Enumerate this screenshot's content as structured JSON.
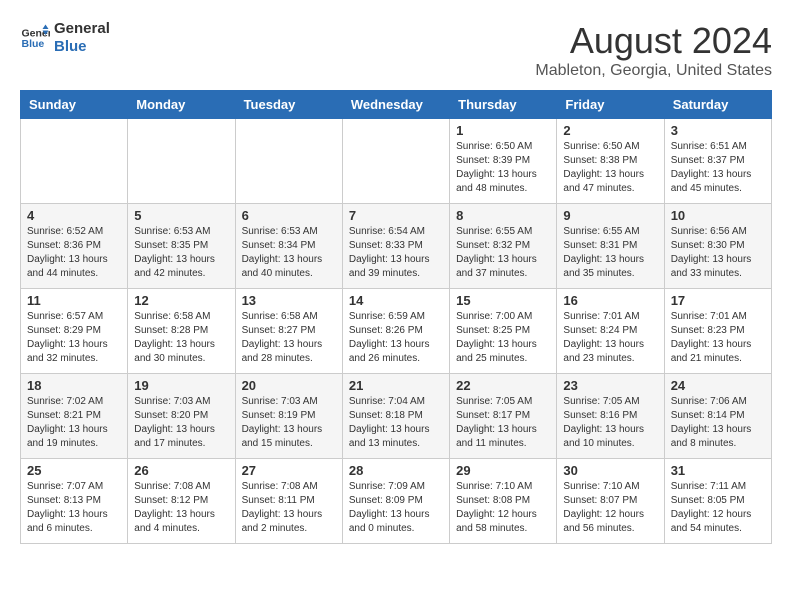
{
  "header": {
    "logo_line1": "General",
    "logo_line2": "Blue",
    "month_year": "August 2024",
    "location": "Mableton, Georgia, United States"
  },
  "days_of_week": [
    "Sunday",
    "Monday",
    "Tuesday",
    "Wednesday",
    "Thursday",
    "Friday",
    "Saturday"
  ],
  "weeks": [
    [
      {
        "day": "",
        "sunrise": "",
        "sunset": "",
        "daylight": ""
      },
      {
        "day": "",
        "sunrise": "",
        "sunset": "",
        "daylight": ""
      },
      {
        "day": "",
        "sunrise": "",
        "sunset": "",
        "daylight": ""
      },
      {
        "day": "",
        "sunrise": "",
        "sunset": "",
        "daylight": ""
      },
      {
        "day": "1",
        "sunrise": "Sunrise: 6:50 AM",
        "sunset": "Sunset: 8:39 PM",
        "daylight": "Daylight: 13 hours and 48 minutes."
      },
      {
        "day": "2",
        "sunrise": "Sunrise: 6:50 AM",
        "sunset": "Sunset: 8:38 PM",
        "daylight": "Daylight: 13 hours and 47 minutes."
      },
      {
        "day": "3",
        "sunrise": "Sunrise: 6:51 AM",
        "sunset": "Sunset: 8:37 PM",
        "daylight": "Daylight: 13 hours and 45 minutes."
      }
    ],
    [
      {
        "day": "4",
        "sunrise": "Sunrise: 6:52 AM",
        "sunset": "Sunset: 8:36 PM",
        "daylight": "Daylight: 13 hours and 44 minutes."
      },
      {
        "day": "5",
        "sunrise": "Sunrise: 6:53 AM",
        "sunset": "Sunset: 8:35 PM",
        "daylight": "Daylight: 13 hours and 42 minutes."
      },
      {
        "day": "6",
        "sunrise": "Sunrise: 6:53 AM",
        "sunset": "Sunset: 8:34 PM",
        "daylight": "Daylight: 13 hours and 40 minutes."
      },
      {
        "day": "7",
        "sunrise": "Sunrise: 6:54 AM",
        "sunset": "Sunset: 8:33 PM",
        "daylight": "Daylight: 13 hours and 39 minutes."
      },
      {
        "day": "8",
        "sunrise": "Sunrise: 6:55 AM",
        "sunset": "Sunset: 8:32 PM",
        "daylight": "Daylight: 13 hours and 37 minutes."
      },
      {
        "day": "9",
        "sunrise": "Sunrise: 6:55 AM",
        "sunset": "Sunset: 8:31 PM",
        "daylight": "Daylight: 13 hours and 35 minutes."
      },
      {
        "day": "10",
        "sunrise": "Sunrise: 6:56 AM",
        "sunset": "Sunset: 8:30 PM",
        "daylight": "Daylight: 13 hours and 33 minutes."
      }
    ],
    [
      {
        "day": "11",
        "sunrise": "Sunrise: 6:57 AM",
        "sunset": "Sunset: 8:29 PM",
        "daylight": "Daylight: 13 hours and 32 minutes."
      },
      {
        "day": "12",
        "sunrise": "Sunrise: 6:58 AM",
        "sunset": "Sunset: 8:28 PM",
        "daylight": "Daylight: 13 hours and 30 minutes."
      },
      {
        "day": "13",
        "sunrise": "Sunrise: 6:58 AM",
        "sunset": "Sunset: 8:27 PM",
        "daylight": "Daylight: 13 hours and 28 minutes."
      },
      {
        "day": "14",
        "sunrise": "Sunrise: 6:59 AM",
        "sunset": "Sunset: 8:26 PM",
        "daylight": "Daylight: 13 hours and 26 minutes."
      },
      {
        "day": "15",
        "sunrise": "Sunrise: 7:00 AM",
        "sunset": "Sunset: 8:25 PM",
        "daylight": "Daylight: 13 hours and 25 minutes."
      },
      {
        "day": "16",
        "sunrise": "Sunrise: 7:01 AM",
        "sunset": "Sunset: 8:24 PM",
        "daylight": "Daylight: 13 hours and 23 minutes."
      },
      {
        "day": "17",
        "sunrise": "Sunrise: 7:01 AM",
        "sunset": "Sunset: 8:23 PM",
        "daylight": "Daylight: 13 hours and 21 minutes."
      }
    ],
    [
      {
        "day": "18",
        "sunrise": "Sunrise: 7:02 AM",
        "sunset": "Sunset: 8:21 PM",
        "daylight": "Daylight: 13 hours and 19 minutes."
      },
      {
        "day": "19",
        "sunrise": "Sunrise: 7:03 AM",
        "sunset": "Sunset: 8:20 PM",
        "daylight": "Daylight: 13 hours and 17 minutes."
      },
      {
        "day": "20",
        "sunrise": "Sunrise: 7:03 AM",
        "sunset": "Sunset: 8:19 PM",
        "daylight": "Daylight: 13 hours and 15 minutes."
      },
      {
        "day": "21",
        "sunrise": "Sunrise: 7:04 AM",
        "sunset": "Sunset: 8:18 PM",
        "daylight": "Daylight: 13 hours and 13 minutes."
      },
      {
        "day": "22",
        "sunrise": "Sunrise: 7:05 AM",
        "sunset": "Sunset: 8:17 PM",
        "daylight": "Daylight: 13 hours and 11 minutes."
      },
      {
        "day": "23",
        "sunrise": "Sunrise: 7:05 AM",
        "sunset": "Sunset: 8:16 PM",
        "daylight": "Daylight: 13 hours and 10 minutes."
      },
      {
        "day": "24",
        "sunrise": "Sunrise: 7:06 AM",
        "sunset": "Sunset: 8:14 PM",
        "daylight": "Daylight: 13 hours and 8 minutes."
      }
    ],
    [
      {
        "day": "25",
        "sunrise": "Sunrise: 7:07 AM",
        "sunset": "Sunset: 8:13 PM",
        "daylight": "Daylight: 13 hours and 6 minutes."
      },
      {
        "day": "26",
        "sunrise": "Sunrise: 7:08 AM",
        "sunset": "Sunset: 8:12 PM",
        "daylight": "Daylight: 13 hours and 4 minutes."
      },
      {
        "day": "27",
        "sunrise": "Sunrise: 7:08 AM",
        "sunset": "Sunset: 8:11 PM",
        "daylight": "Daylight: 13 hours and 2 minutes."
      },
      {
        "day": "28",
        "sunrise": "Sunrise: 7:09 AM",
        "sunset": "Sunset: 8:09 PM",
        "daylight": "Daylight: 13 hours and 0 minutes."
      },
      {
        "day": "29",
        "sunrise": "Sunrise: 7:10 AM",
        "sunset": "Sunset: 8:08 PM",
        "daylight": "Daylight: 12 hours and 58 minutes."
      },
      {
        "day": "30",
        "sunrise": "Sunrise: 7:10 AM",
        "sunset": "Sunset: 8:07 PM",
        "daylight": "Daylight: 12 hours and 56 minutes."
      },
      {
        "day": "31",
        "sunrise": "Sunrise: 7:11 AM",
        "sunset": "Sunset: 8:05 PM",
        "daylight": "Daylight: 12 hours and 54 minutes."
      }
    ]
  ]
}
